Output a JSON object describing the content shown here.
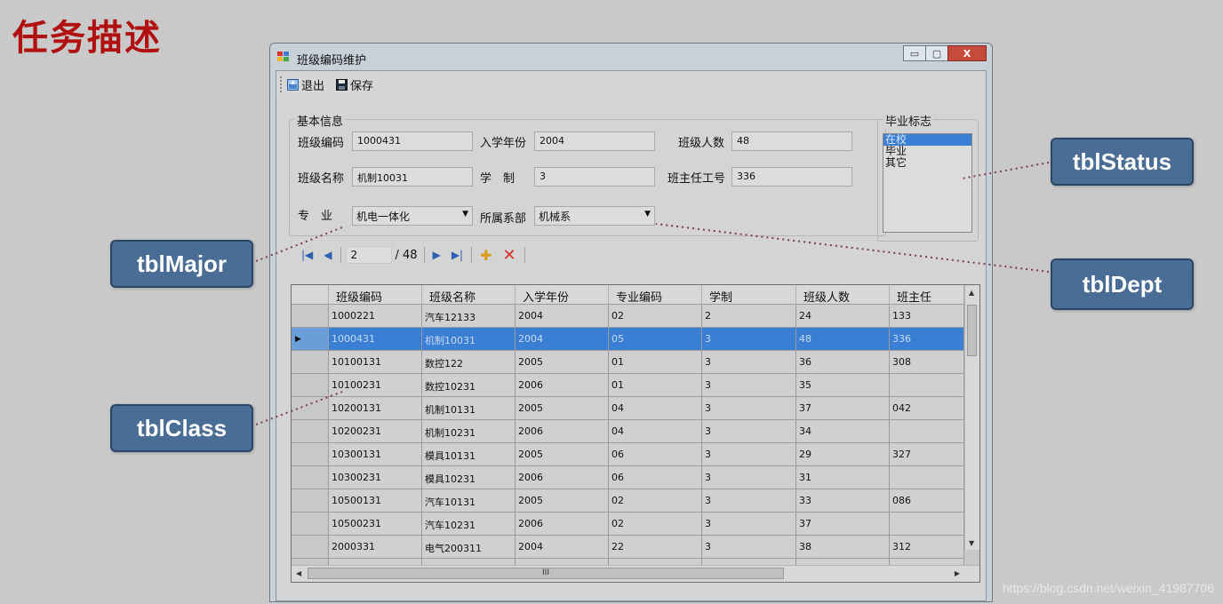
{
  "slide": {
    "title": "任务描述",
    "watermark": "https://blog.csdn.net/weixin_41987706"
  },
  "callouts": {
    "status": "tblStatus",
    "major": "tblMajor",
    "dept": "tblDept",
    "class": "tblClass"
  },
  "window": {
    "title": "班级编码维护",
    "minimize_glyph": "▭",
    "maximize_glyph": "▢",
    "close_glyph": "X"
  },
  "toolbar": {
    "exit_label": "退出",
    "save_label": "保存"
  },
  "basic_info": {
    "group_title": "基本信息",
    "fields": {
      "class_code": {
        "label": "班级编码",
        "value": "1000431"
      },
      "enroll_year": {
        "label": "入学年份",
        "value": "2004"
      },
      "class_size": {
        "label": "班级人数",
        "value": "48"
      },
      "class_name": {
        "label": "班级名称",
        "value": "机制10031"
      },
      "duration": {
        "label": "学　制",
        "value": "3"
      },
      "teacher_id": {
        "label": "班主任工号",
        "value": "336"
      },
      "major": {
        "label": "专　业",
        "value": "机电一体化"
      },
      "dept": {
        "label": "所属系部",
        "value": "机械系"
      }
    }
  },
  "graduation": {
    "group_title": "毕业标志",
    "options": [
      "在校",
      "毕业",
      "其它"
    ],
    "selected_index": 0
  },
  "navigator": {
    "position": "2",
    "count": "/ 48"
  },
  "grid": {
    "columns": [
      "班级编码",
      "班级名称",
      "入学年份",
      "专业编码",
      "学制",
      "班级人数",
      "班主任"
    ],
    "rows": [
      [
        "1000221",
        "汽车12133",
        "2004",
        "02",
        "2",
        "24",
        "133"
      ],
      [
        "1000431",
        "机制10031",
        "2004",
        "05",
        "3",
        "48",
        "336"
      ],
      [
        "10100131",
        "数控122",
        "2005",
        "01",
        "3",
        "36",
        "308"
      ],
      [
        "10100231",
        "数控10231",
        "2006",
        "01",
        "3",
        "35",
        ""
      ],
      [
        "10200131",
        "机制10131",
        "2005",
        "04",
        "3",
        "37",
        "042"
      ],
      [
        "10200231",
        "机制10231",
        "2006",
        "04",
        "3",
        "34",
        ""
      ],
      [
        "10300131",
        "模具10131",
        "2005",
        "06",
        "3",
        "29",
        "327"
      ],
      [
        "10300231",
        "模具10231",
        "2006",
        "06",
        "3",
        "31",
        ""
      ],
      [
        "10500131",
        "汽车10131",
        "2005",
        "02",
        "3",
        "33",
        "086"
      ],
      [
        "10500231",
        "汽车10231",
        "2006",
        "02",
        "3",
        "37",
        ""
      ],
      [
        "2000331",
        "电气200311",
        "2004",
        "22",
        "3",
        "38",
        "312"
      ],
      [
        "",
        "",
        "",
        "",
        "",
        "",
        ""
      ]
    ],
    "selected_row": 1,
    "current_row_marker": "▶",
    "hscroll_glyph": "III"
  },
  "colors": {
    "title_red": "#b01010",
    "callout_blue": "#4a6d95",
    "selection_blue": "#3a7fd3",
    "leader_line": "#7a3b4a"
  }
}
